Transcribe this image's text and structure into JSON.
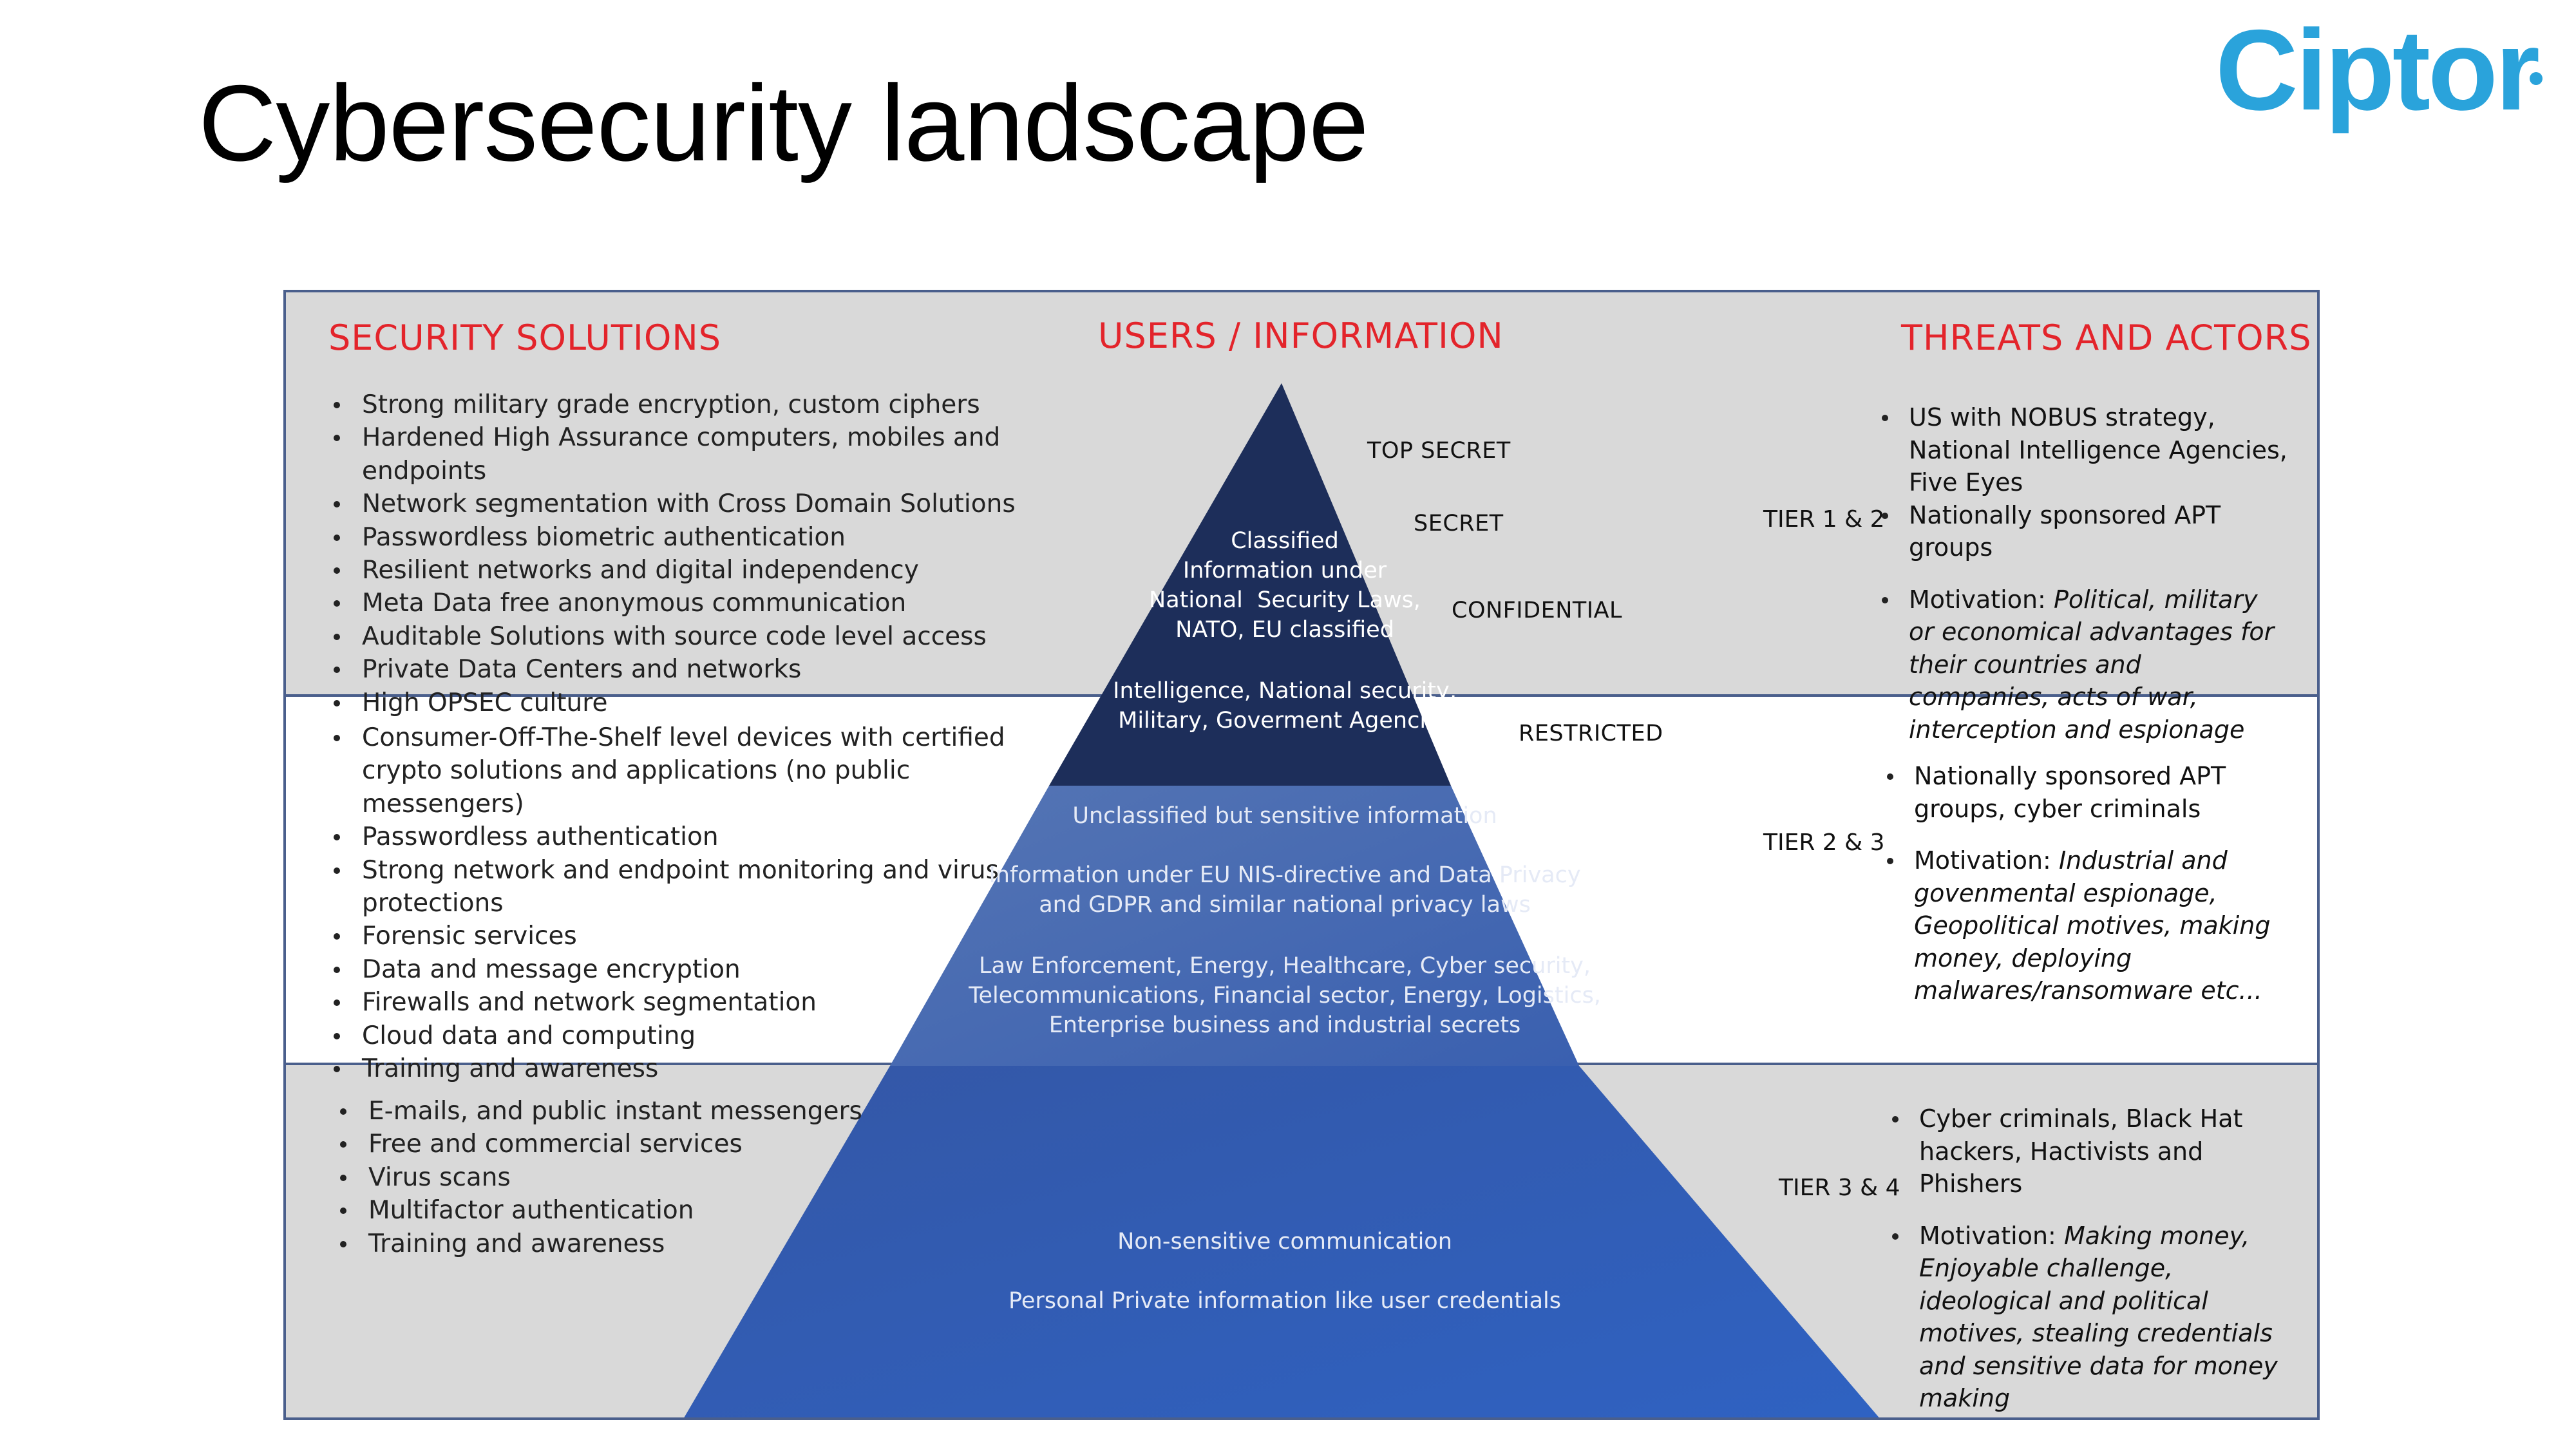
{
  "page": {
    "title": "Cybersecurity landscape",
    "logo_text": "Ciptor"
  },
  "colors": {
    "heading_red": "#e3242b",
    "logo_blue": "#2aa3db",
    "band_grey": "#d9d9d9",
    "frame": "#4a5f8c",
    "pyramid_top": "#1d2e5a",
    "pyramid_mid": "#4a6cb0",
    "pyramid_bottom": "#2f5db6"
  },
  "headers": {
    "security_solutions": "SECURITY SOLUTIONS",
    "users_information": "USERS / INFORMATION",
    "threats_actors": "THREATS AND ACTORS"
  },
  "solutions": {
    "tier1": [
      "Strong military grade encryption, custom ciphers",
      "Hardened High Assurance computers, mobiles and endpoints",
      "Network segmentation with Cross Domain Solutions",
      "Passwordless biometric authentication",
      "Resilient networks and digital independency",
      "Meta Data free anonymous communication",
      "Auditable Solutions with source code level access",
      "Private Data Centers and networks",
      "High OPSEC culture"
    ],
    "tier2": [
      "Consumer-Off-The-Shelf level devices with certified crypto solutions and applications (no public messengers)",
      "Passwordless authentication",
      "Strong network and endpoint monitoring and virus protections",
      "Forensic services",
      "Data and message encryption",
      "Firewalls and network segmentation",
      "Cloud data and computing",
      "Training and awareness"
    ],
    "tier3": [
      "E-mails, and public instant messengers",
      "Free and commercial services",
      "Virus scans",
      "Multifactor authentication",
      "Training and awareness"
    ]
  },
  "levels": {
    "top_secret": "TOP SECRET",
    "secret": "SECRET",
    "confidential": "CONFIDENTIAL",
    "restricted": "RESTRICTED"
  },
  "pyramid": {
    "classified": [
      "Classified",
      "Information under",
      "National  Security Laws,",
      "NATO, EU classified"
    ],
    "agencies": [
      "Intelligence, National security,",
      "Military, Goverment Agencies"
    ],
    "unclassified": "Unclassified but sensitive information",
    "nis": [
      "Information under EU NIS-directive and Data Privacy",
      "and GDPR and similar national privacy laws"
    ],
    "sectors": [
      "Law Enforcement, Energy, Healthcare, Cyber security,",
      "Telecommunications, Financial sector, Energy, Logistics,",
      "Enterprise business and industrial secrets"
    ],
    "non_sensitive": "Non-sensitive communication",
    "personal": "Personal Private information like user credentials"
  },
  "tiers": {
    "t12": "TIER 1 & 2",
    "t23": "TIER 2 & 3",
    "t34": "TIER 3 & 4"
  },
  "threats": {
    "motivation_label": "Motivation: ",
    "tier1_actor_1": "US with NOBUS strategy, National Intelligence Agencies, Five Eyes",
    "tier1_actor_2": "Nationally sponsored APT groups",
    "tier1_motivation": "Political, military or economical advantages for their countries and companies,  acts of war, interception and espionage",
    "tier2_actor": "Nationally sponsored APT groups, cyber criminals",
    "tier2_motivation": "Industrial and govenmental espionage, Geopolitical motives, making money, deploying malwares/ransomware etc...",
    "tier3_actor": "Cyber criminals, Black Hat hackers, Hactivists and  Phishers",
    "tier3_motivation": "Making money, Enjoyable challenge, ideological and political motives, stealing credentials and sensitive data for money making"
  }
}
